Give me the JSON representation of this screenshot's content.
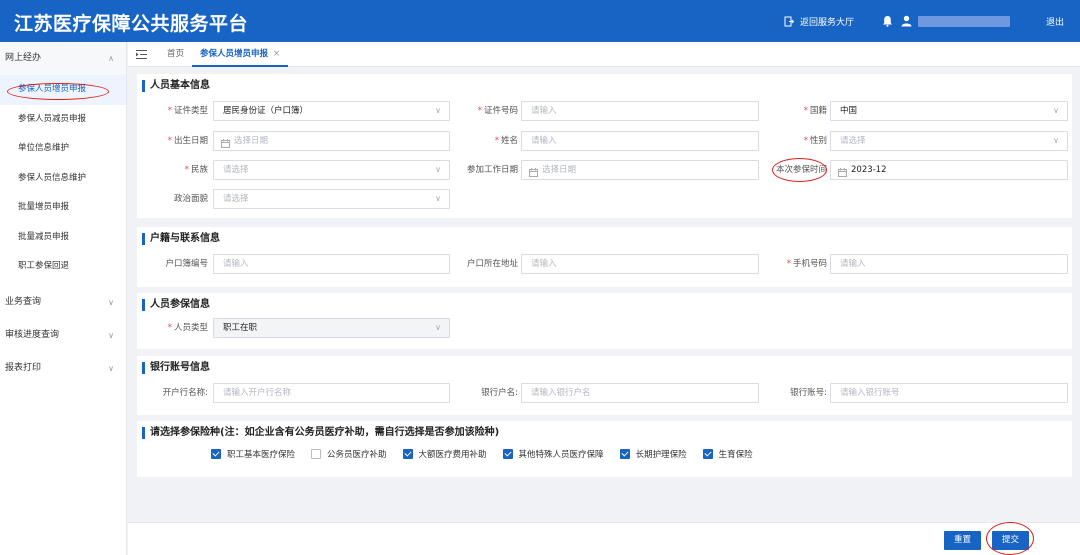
{
  "header": {
    "title": "江苏医疗保障公共服务平台",
    "return_label": "返回服务大厅",
    "logout_label": "退出"
  },
  "sidebar": {
    "groups": [
      {
        "label": "网上经办",
        "items": [
          "参保人员增员申报",
          "参保人员减员申报",
          "单位信息维护",
          "参保人员信息维护",
          "批量增员申报",
          "批量减员申报",
          "职工参保回退"
        ]
      },
      {
        "label": "业务查询"
      },
      {
        "label": "审核进度查询"
      },
      {
        "label": "报表打印"
      }
    ],
    "active_item": "参保人员增员申报"
  },
  "tabs": [
    {
      "label": "首页"
    },
    {
      "label": "参保人员增员申报",
      "close": "×"
    }
  ],
  "sections": {
    "basic": {
      "title": "人员基本信息",
      "fields": {
        "id_type": {
          "label": "证件类型",
          "required": "*",
          "value": "居民身份证（户口簿）"
        },
        "id_number": {
          "label": "证件号码",
          "required": "*",
          "placeholder": "请输入"
        },
        "nationality": {
          "label": "国籍",
          "required": "*",
          "value": "中国"
        },
        "birth_date": {
          "label": "出生日期",
          "required": "*",
          "placeholder": "选择日期"
        },
        "name": {
          "label": "姓名",
          "required": "*",
          "placeholder": "请输入"
        },
        "gender": {
          "label": "性别",
          "required": "*",
          "placeholder": "请选择"
        },
        "ethnicity": {
          "label": "民族",
          "required": "*",
          "placeholder": "请选择"
        },
        "work_start": {
          "label": "参加工作日期",
          "placeholder": "选择日期"
        },
        "insure_time": {
          "label": "本次参保时间",
          "value": "2023-12"
        },
        "politics": {
          "label": "政治面貌",
          "placeholder": "请选择"
        }
      }
    },
    "household": {
      "title": "户籍与联系信息",
      "fields": {
        "hukou_no": {
          "label": "户口簿编号",
          "placeholder": "请输入"
        },
        "hukou_addr": {
          "label": "户口所在地址",
          "placeholder": "请输入"
        },
        "mobile": {
          "label": "手机号码",
          "required": "*",
          "placeholder": "请输入"
        }
      }
    },
    "insured": {
      "title": "人员参保信息",
      "fields": {
        "person_type": {
          "label": "人员类型",
          "required": "*",
          "value": "职工在职"
        }
      }
    },
    "bank": {
      "title": "银行账号信息",
      "fields": {
        "bank_name": {
          "label": "开户行名称:",
          "placeholder": "请输入开户行名称"
        },
        "account_name": {
          "label": "银行户名:",
          "placeholder": "请输入银行户名"
        },
        "account_no": {
          "label": "银行账号:",
          "placeholder": "请输入银行账号"
        }
      }
    },
    "insurance": {
      "title": "请选择参保险种(注：如企业含有公务员医疗补助，需自行选择是否参加该险种)",
      "options": [
        {
          "label": "职工基本医疗保险",
          "checked": true
        },
        {
          "label": "公务员医疗补助",
          "checked": false
        },
        {
          "label": "大额医疗费用补助",
          "checked": true
        },
        {
          "label": "其他特殊人员医疗保障",
          "checked": true
        },
        {
          "label": "长期护理保险",
          "checked": true
        },
        {
          "label": "生育保险",
          "checked": true
        }
      ]
    }
  },
  "footer": {
    "reset_label": "重置",
    "submit_label": "提交"
  },
  "icons": {
    "dropdown": "∨",
    "expanded": "∧"
  },
  "colors": {
    "primary": "#1764c4",
    "annotation": "#e02020",
    "required": "#e54848"
  }
}
